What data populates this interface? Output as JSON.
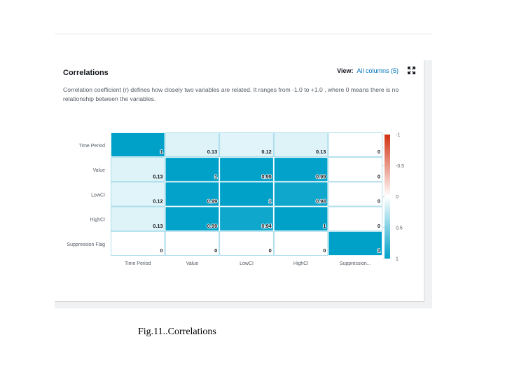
{
  "panel": {
    "title": "Correlations",
    "view_label": "View:",
    "view_value": "All columns (5)",
    "description": "Correlation coefficient (r) defines how closely two variables are related. It ranges from -1.0 to +1.0 , where 0 means there is no relationship between the variables."
  },
  "chart_data": {
    "type": "heatmap",
    "title": "",
    "row_labels": [
      "Time Period",
      "Value",
      "LowCI",
      "HighCI",
      "Suppression Flag"
    ],
    "col_labels": [
      "Time Period",
      "Value",
      "LowCI",
      "HighCI",
      "Suppression..."
    ],
    "values": [
      [
        1,
        0.13,
        0.12,
        0.13,
        0
      ],
      [
        0.13,
        1,
        0.99,
        0.99,
        0
      ],
      [
        0.12,
        0.99,
        1,
        0.94,
        0
      ],
      [
        0.13,
        0.99,
        0.94,
        1,
        0
      ],
      [
        0,
        0,
        0,
        0,
        1
      ]
    ],
    "value_labels": [
      [
        "1",
        "0.13",
        "0.12",
        "0.13",
        "0"
      ],
      [
        "0.13",
        "1",
        "0.99",
        "0.99",
        "0"
      ],
      [
        "0.12",
        "0.99",
        "1",
        "0.94",
        "0"
      ],
      [
        "0.13",
        "0.99",
        "0.94",
        "1",
        "0"
      ],
      [
        "0",
        "0",
        "0",
        "0",
        "1"
      ]
    ],
    "colorbar": {
      "range": [
        -1,
        1
      ],
      "ticks": [
        -1,
        -0.5,
        0,
        0.5,
        1
      ],
      "tick_labels": [
        "-1",
        "-0.5",
        "0",
        "0.5",
        "1"
      ],
      "negative_color": "#d13212",
      "zero_color": "#ffffff",
      "positive_color": "#00a1c9"
    }
  },
  "caption": "Fig.11..Correlations"
}
